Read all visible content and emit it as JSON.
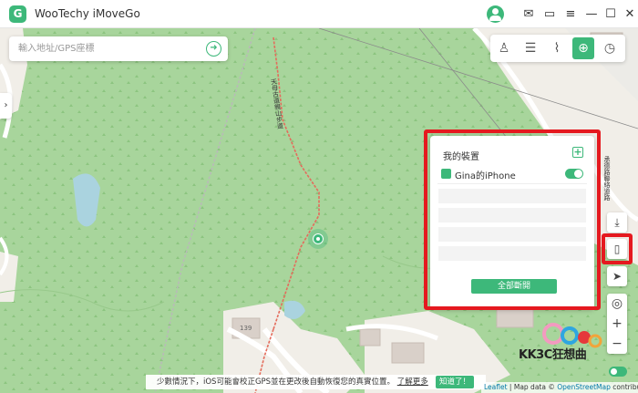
{
  "app": {
    "title": "WooTechy iMoveGo",
    "logo_letter": "G"
  },
  "titlebar": {
    "icons": [
      "user-icon",
      "mail-icon",
      "feedback-icon",
      "menu-icon",
      "minimize-icon",
      "maximize-icon",
      "close-icon"
    ],
    "glyphs": {
      "mail": "✉",
      "feedback": "▭",
      "menu": "≡",
      "minimize": "—",
      "maximize": "☐",
      "close": "✕"
    }
  },
  "search": {
    "placeholder": "輸入地址/GPS座標",
    "value": "",
    "go_glyph": "➜"
  },
  "side_toggle": "›",
  "modes": [
    {
      "name": "joystick-mode",
      "glyph": "♙",
      "active": false
    },
    {
      "name": "multi-spot-mode",
      "glyph": "☰",
      "active": false
    },
    {
      "name": "two-spot-mode",
      "glyph": "⌇",
      "active": false
    },
    {
      "name": "teleport-mode",
      "glyph": "⊕",
      "active": true
    },
    {
      "name": "history-mode",
      "glyph": "◷",
      "active": false
    }
  ],
  "device_panel": {
    "title": "我的裝置",
    "add_glyph": "+",
    "device": {
      "name": "Gina的iPhone",
      "connected": true
    },
    "disconnect_all": "全部斷開"
  },
  "right_buttons": {
    "download": "⤓",
    "device": "▯",
    "navigate": "➤",
    "locate": "◎",
    "zoom_in": "+",
    "zoom_out": "−"
  },
  "map": {
    "road_labels": [
      "天母古道親山步道",
      "承德路聯絡道路"
    ],
    "house_number": "139"
  },
  "notice": {
    "text": "少數情況下，iOS可能會校正GPS並在更改後自動恢復您的真實位置。",
    "link": "了解更多",
    "button": "知道了！"
  },
  "attribution": {
    "prefix": "Leaflet",
    "middle": " | Map data © ",
    "source": "OpenStreetMap",
    "suffix": " contributors"
  },
  "watermark": {
    "text": "KK3C狂想曲"
  },
  "colors": {
    "accent": "#3db87a",
    "highlight": "#e5191f",
    "map_green": "#a8d59c"
  }
}
